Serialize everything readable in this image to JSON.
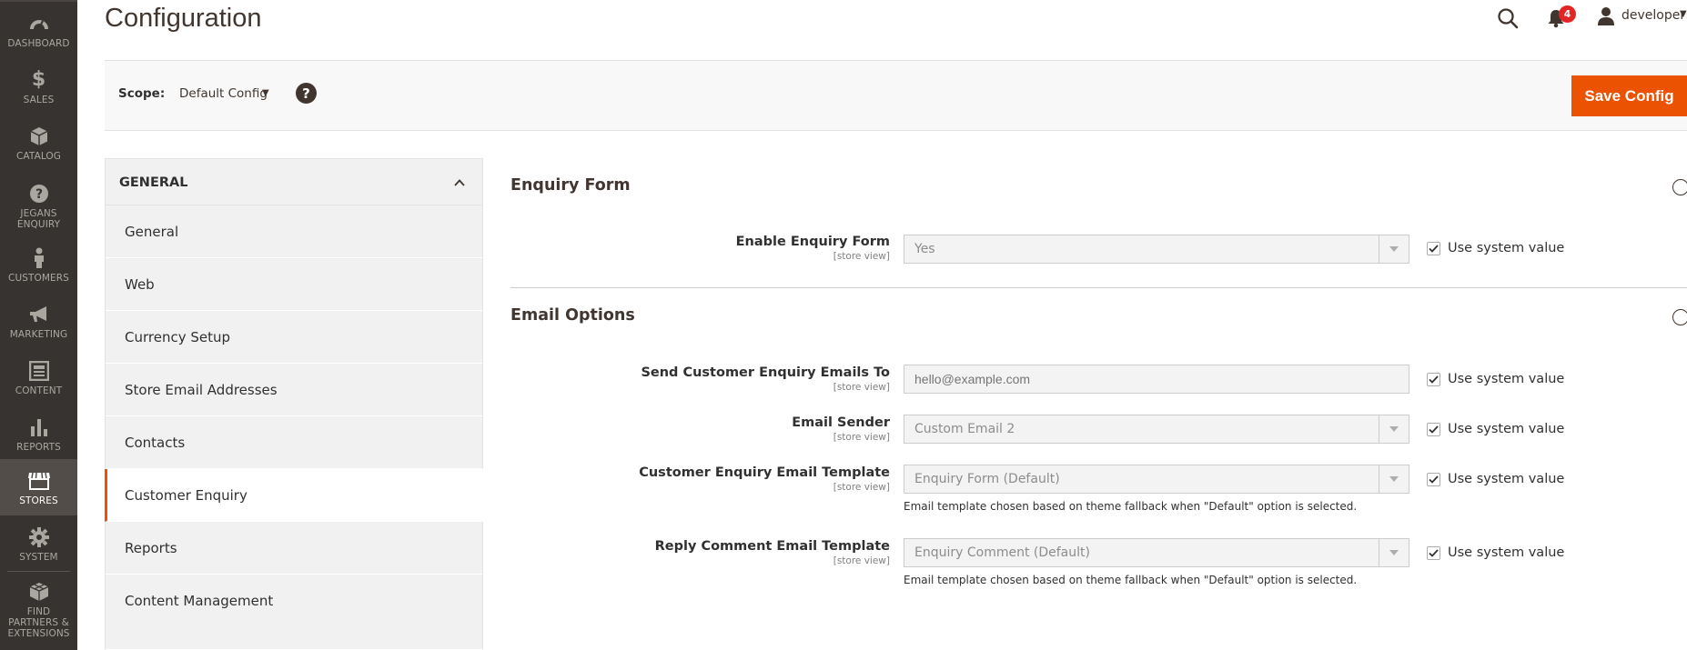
{
  "admin_nav": {
    "items": [
      {
        "label": "DASHBOARD",
        "icon": "speedometer-icon"
      },
      {
        "label": "SALES",
        "icon": "dollar-icon"
      },
      {
        "label": "CATALOG",
        "icon": "box-icon"
      },
      {
        "label": "JEGANS ENQUIRY",
        "icon": "question-icon"
      },
      {
        "label": "CUSTOMERS",
        "icon": "person-icon"
      },
      {
        "label": "MARKETING",
        "icon": "megaphone-icon"
      },
      {
        "label": "CONTENT",
        "icon": "layout-icon"
      },
      {
        "label": "REPORTS",
        "icon": "bar-chart-icon"
      },
      {
        "label": "STORES",
        "icon": "store-icon"
      },
      {
        "label": "SYSTEM",
        "icon": "gear-icon"
      },
      {
        "label": "FIND PARTNERS & EXTENSIONS",
        "icon": "cubes-icon"
      }
    ]
  },
  "header": {
    "title": "Configuration",
    "notification_count": "4",
    "user_name": "developer"
  },
  "scope": {
    "label": "Scope:",
    "value": "Default Config",
    "help": "?",
    "save_label": "Save Config"
  },
  "config_nav": {
    "group_title": "GENERAL",
    "tabs": [
      "General",
      "Web",
      "Currency Setup",
      "Store Email Addresses",
      "Contacts",
      "Customer Enquiry",
      "Reports",
      "Content Management"
    ]
  },
  "sections": {
    "enquiry_form": {
      "title": "Enquiry Form",
      "fields": {
        "enable": {
          "label": "Enable Enquiry Form",
          "scope": "[store view]",
          "value": "Yes",
          "use_system": "Use system value"
        }
      }
    },
    "email_options": {
      "title": "Email Options",
      "fields": {
        "send_to": {
          "label": "Send Customer Enquiry Emails To",
          "scope": "[store view]",
          "placeholder": "hello@example.com",
          "use_system": "Use system value"
        },
        "sender": {
          "label": "Email Sender",
          "scope": "[store view]",
          "value": "Custom Email 2",
          "use_system": "Use system value"
        },
        "customer_template": {
          "label": "Customer Enquiry Email Template",
          "scope": "[store view]",
          "value": "Enquiry Form (Default)",
          "use_system": "Use system value",
          "note": "Email template chosen based on theme fallback when \"Default\" option is selected."
        },
        "reply_template": {
          "label": "Reply Comment Email Template",
          "scope": "[store view]",
          "value": "Enquiry Comment (Default)",
          "use_system": "Use system value",
          "note": "Email template chosen based on theme fallback when \"Default\" option is selected."
        }
      }
    }
  },
  "colors": {
    "nav_bg": "#373330",
    "accent": "#eb5202",
    "badge": "#e22626"
  }
}
